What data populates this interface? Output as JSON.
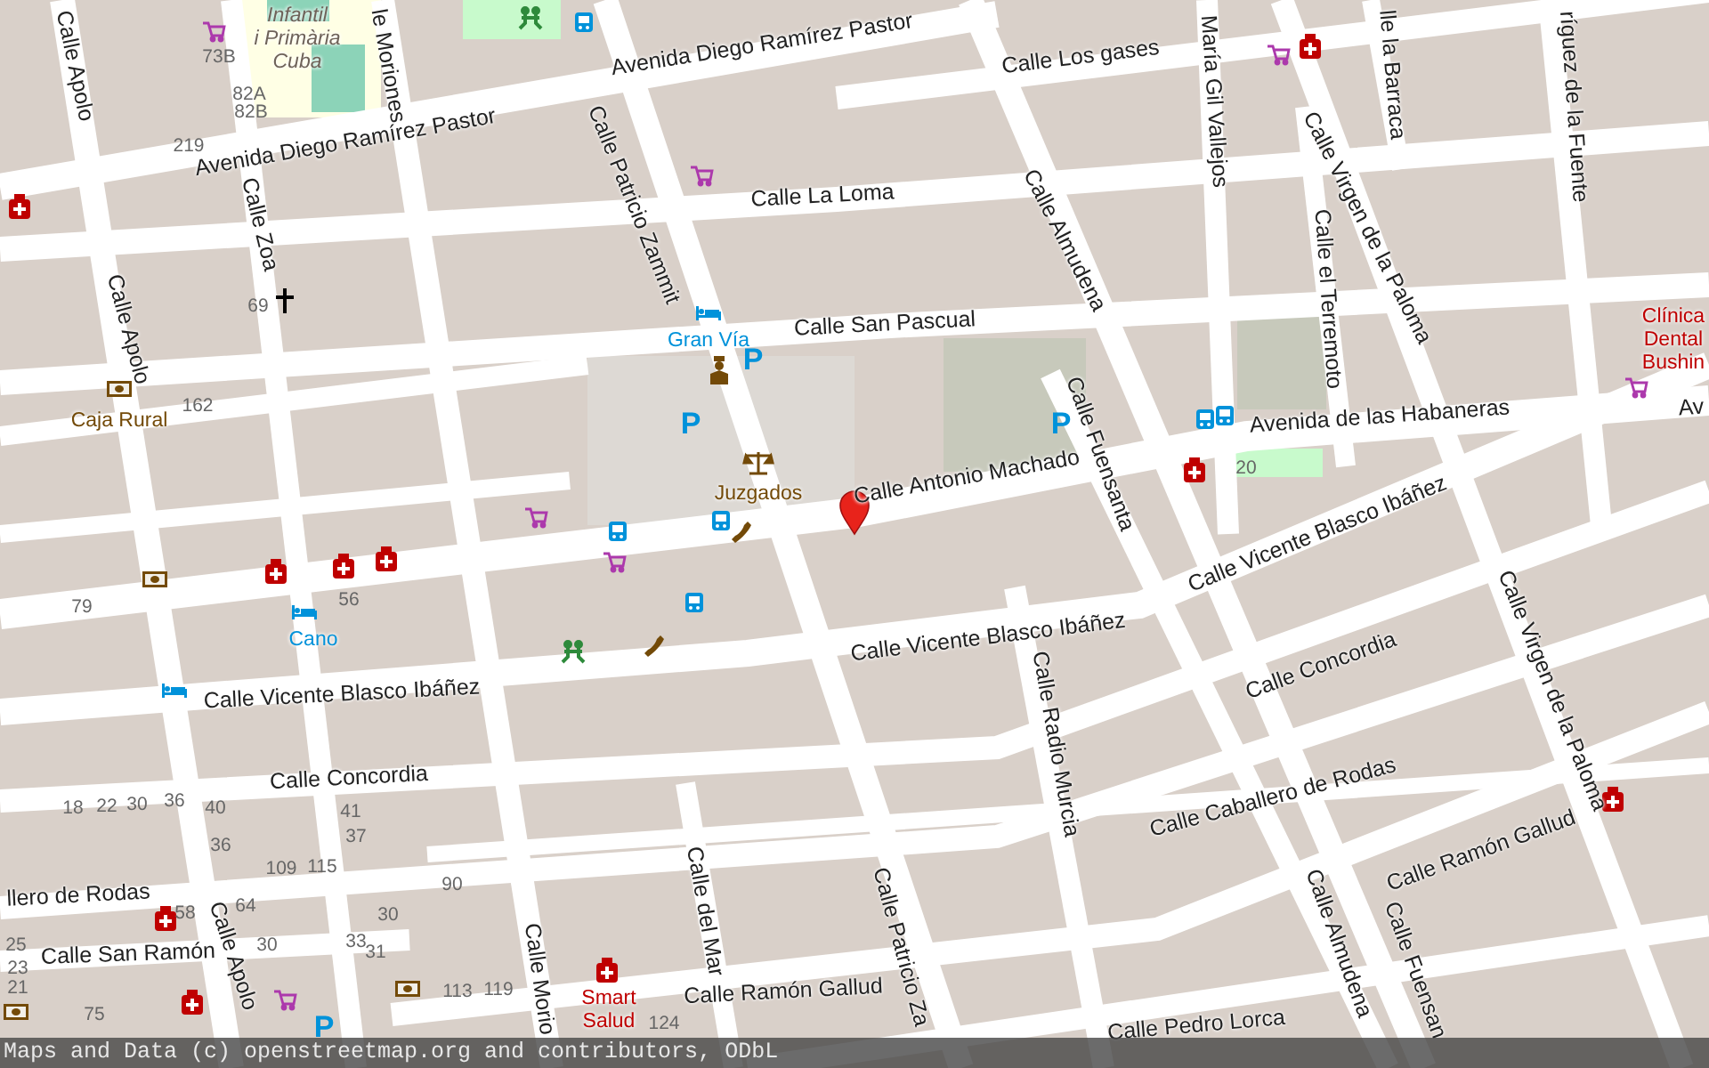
{
  "map": {
    "street_labels": [
      {
        "name": "Calle Apolo"
      },
      {
        "name": "le Moriones"
      },
      {
        "name": "Avenida Diego Ramírez Pastor"
      },
      {
        "name": "Avenida Diego Ramírez Pastor"
      },
      {
        "name": "Calle Los gases"
      },
      {
        "name": "María Gil Vallejos"
      },
      {
        "name": "lle la Barraca"
      },
      {
        "name": "ríguez de la Fuente"
      },
      {
        "name": "Calle La Loma"
      },
      {
        "name": "Calle Zoa"
      },
      {
        "name": "Calle Apolo"
      },
      {
        "name": "Calle Patricio Zammit"
      },
      {
        "name": "Calle Almudena"
      },
      {
        "name": "Calle Virgen de la Paloma"
      },
      {
        "name": "Calle el Terremoto"
      },
      {
        "name": "Calle San Pascual"
      },
      {
        "name": "Calle Antonio Machado"
      },
      {
        "name": "Calle Fuensanta"
      },
      {
        "name": "Avenida de las Habaneras"
      },
      {
        "name": "Av"
      },
      {
        "name": "Calle Vicente Blasco Ibáñez"
      },
      {
        "name": "Calle Vicente Blasco Ibáñez"
      },
      {
        "name": "Calle Vicente Blasco Ibáñez"
      },
      {
        "name": "Calle Concordia"
      },
      {
        "name": "Calle Concordia"
      },
      {
        "name": "Calle Virgen de la Paloma"
      },
      {
        "name": "Calle Radio Murcia"
      },
      {
        "name": "Calle Caballero de Rodas"
      },
      {
        "name": "Calle Ramón Gallud"
      },
      {
        "name": "llero de Rodas"
      },
      {
        "name": "Calle San Ramón"
      },
      {
        "name": "Calle Apolo"
      },
      {
        "name": "Calle del Mar"
      },
      {
        "name": "Calle Morio"
      },
      {
        "name": "Calle Ramón Gallud"
      },
      {
        "name": "Calle Almudena"
      },
      {
        "name": "Calle Patricio Za"
      },
      {
        "name": "Calle Fuensan"
      },
      {
        "name": "Calle Pedro Lorca"
      }
    ],
    "places": [
      {
        "name": "Infantil\ni Primària\nCuba",
        "kind": "school"
      },
      {
        "name": "Gran Vía",
        "kind": "hotel"
      },
      {
        "name": "Caja Rural",
        "kind": "amenity"
      },
      {
        "name": "Juzgados",
        "kind": "amenity"
      },
      {
        "name": "Cano",
        "kind": "hotel"
      },
      {
        "name": "Smart\nSalud",
        "kind": "health"
      },
      {
        "name": "Clínica\nDental\nBushin",
        "kind": "health"
      }
    ],
    "house_numbers": [
      "73B",
      "82A",
      "82B",
      "219",
      "69",
      "162",
      "79",
      "56",
      "18",
      "22",
      "30",
      "36",
      "40",
      "41",
      "37",
      "36",
      "109",
      "115",
      "90",
      "64",
      "58",
      "30",
      "30",
      "33",
      "31",
      "25",
      "23",
      "21",
      "75",
      "113",
      "119",
      "124",
      "20"
    ],
    "parking_signs": [
      "P",
      "P",
      "P",
      "P"
    ]
  },
  "attribution": "Maps and Data (c) openstreetmap.org and contributors, ODbL"
}
